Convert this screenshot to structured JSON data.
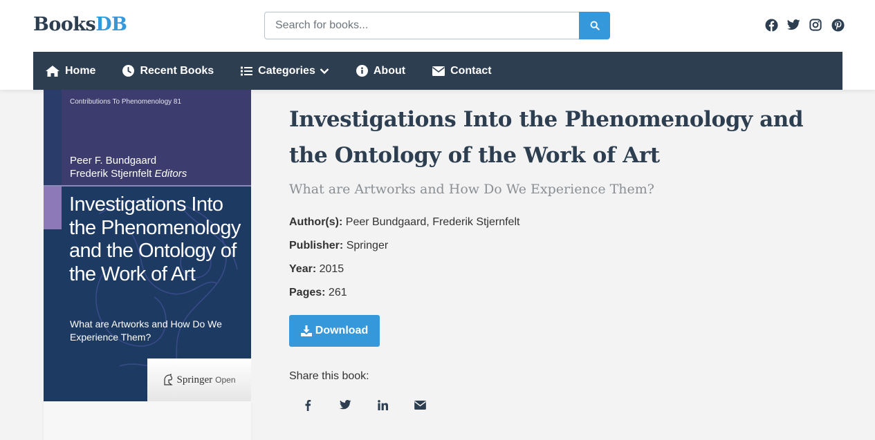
{
  "header": {
    "logo_part1": "Books",
    "logo_part2": "DB",
    "search_placeholder": "Search for books...",
    "social_icons": [
      "facebook-icon",
      "twitter-icon",
      "instagram-icon",
      "pinterest-icon"
    ]
  },
  "nav": {
    "items": [
      {
        "label": "Home",
        "icon": "home-icon"
      },
      {
        "label": "Recent Books",
        "icon": "clock-icon"
      },
      {
        "label": "Categories",
        "icon": "list-icon"
      },
      {
        "label": "About",
        "icon": "info-icon"
      },
      {
        "label": "Contact",
        "icon": "envelope-icon"
      }
    ]
  },
  "cover": {
    "series": "Contributions To Phenomenology   81",
    "editor1": "Peer F. Bundgaard",
    "editor2": "Frederik Stjernfelt",
    "editors_label": "Editors",
    "title": "Investigations Into the Phenomenology and the Ontology of the Work of Art",
    "subtitle": "What are Artworks and How Do We Experience Them?",
    "publisher": "Springer",
    "publisher_suffix": "Open"
  },
  "book": {
    "title": "Investigations Into the Phenomenology and the Ontology of the Work of Art",
    "subtitle": "What are Artworks and How Do We Experience Them?",
    "authors_label": "Author(s):",
    "authors": "Peer Bundgaard, Frederik Stjernfelt",
    "publisher_label": "Publisher:",
    "publisher": "Springer",
    "year_label": "Year:",
    "year": "2015",
    "pages_label": "Pages:",
    "pages": "261"
  },
  "actions": {
    "download_label": "Download",
    "share_label": "Share this book:",
    "share_icons": [
      "facebook-icon",
      "twitter-icon",
      "linkedin-icon",
      "envelope-icon"
    ]
  },
  "colors": {
    "primary": "#2c3e50",
    "accent": "#3498db",
    "background": "#f3f3f3"
  }
}
